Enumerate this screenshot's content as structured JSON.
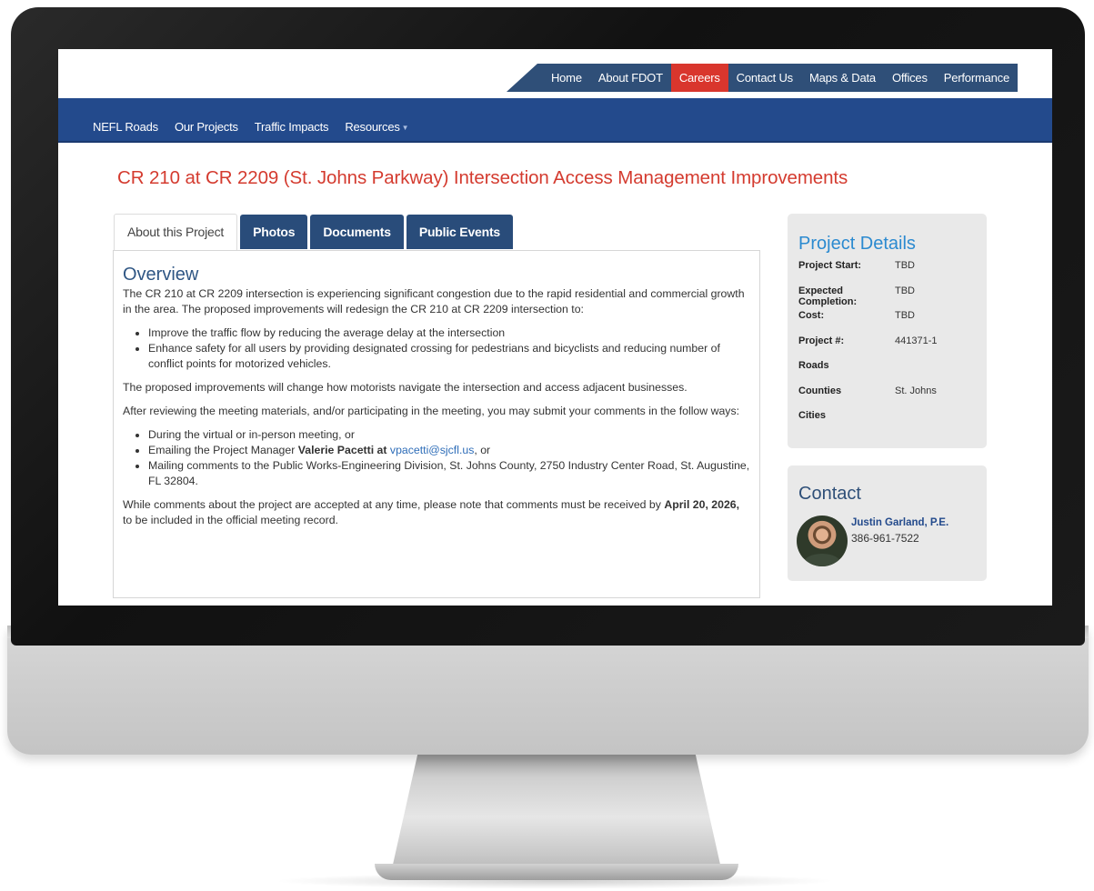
{
  "top_nav": {
    "items": [
      {
        "label": "Home"
      },
      {
        "label": "About FDOT"
      },
      {
        "label": "Careers",
        "active": true
      },
      {
        "label": "Contact Us"
      },
      {
        "label": "Maps & Data"
      },
      {
        "label": "Offices"
      },
      {
        "label": "Performance"
      }
    ]
  },
  "main_nav": {
    "items": [
      {
        "label": "NEFL Roads"
      },
      {
        "label": "Our Projects"
      },
      {
        "label": "Traffic Impacts"
      },
      {
        "label": "Resources"
      }
    ]
  },
  "page_title": "CR 210 at CR 2209 (St. Johns Parkway) Intersection Access Management Improvements",
  "tabs": [
    {
      "label": "About this Project",
      "active": true
    },
    {
      "label": "Photos"
    },
    {
      "label": "Documents"
    },
    {
      "label": "Public Events"
    }
  ],
  "overview": {
    "heading": "Overview",
    "intro": "The CR 210 at CR 2209 intersection is experiencing significant congestion due to the rapid residential and commercial growth in the area. The proposed improvements will redesign the CR 210 at CR 2209 intersection to:",
    "goals": [
      "Improve the traffic flow by reducing the average delay at the intersection",
      "Enhance safety for all users by providing designated crossing for pedestrians and bicyclists and reducing number of conflict points for motorized vehicles."
    ],
    "change_note": "The proposed improvements will change how motorists navigate the intersection and access adjacent businesses.",
    "comment_intro": "After reviewing the meeting materials, and/or participating in the meeting, you may submit your comments in the follow ways:",
    "comment_ways": {
      "meeting": "During the virtual or in-person meeting, or",
      "email_prefix": "Emailing the Project Manager ",
      "email_name": "Valerie Pacetti at",
      "email_address": "vpacetti@sjcfl.us",
      "email_suffix": ", or",
      "mail": "Mailing comments to the Public Works-Engineering Division, St. Johns County, 2750 Industry Center Road, St. Augustine, FL 32804."
    },
    "deadline_prefix": "While comments about the project are accepted at any time, please note that comments must be received by ",
    "deadline_date": "April 20, 2026,",
    "deadline_suffix": " to be included in the official meeting record."
  },
  "project_details": {
    "heading": "Project Details",
    "rows": [
      {
        "label": "Project Start:",
        "value": "TBD"
      },
      {
        "label": "Expected Completion:",
        "value": "TBD"
      },
      {
        "label": "Cost:",
        "value": "TBD"
      },
      {
        "label": "Project #:",
        "value": "441371-1"
      },
      {
        "label": "Roads",
        "value": ""
      },
      {
        "label": "Counties",
        "value": "St. Johns"
      },
      {
        "label": "Cities",
        "value": ""
      }
    ]
  },
  "contact": {
    "heading": "Contact",
    "name": "Justin Garland, P.E.",
    "phone": "386-961-7522"
  },
  "colors": {
    "top_nav_bg": "#2f4f78",
    "active_nav": "#d9362d",
    "main_nav_bg": "#234a8c",
    "title_red": "#d43b2f",
    "panel_heading_blue": "#2b8ad0"
  }
}
